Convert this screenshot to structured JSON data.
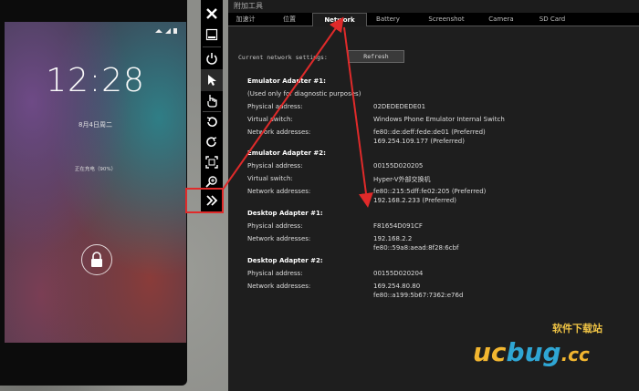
{
  "phone": {
    "clock": "12:28",
    "date": "8月4日周二",
    "charging": "正在充电（90%）",
    "status_icons": "wifi-icon signal-icon battery-icon"
  },
  "toolbar": {
    "items": [
      "close-icon",
      "minimize-icon",
      "power-icon",
      "cursor-icon",
      "touch-icon",
      "rotate-left-icon",
      "rotate-right-icon",
      "fit-screen-icon",
      "zoom-icon",
      "expand-tools-icon"
    ]
  },
  "panel": {
    "title": "附加工具",
    "tabs": [
      "加速计",
      "位置",
      "Network",
      "Battery",
      "Screenshot",
      "Camera",
      "SD Card"
    ],
    "active_tab": "Network",
    "current_label": "Current network settings:",
    "refresh_label": "Refresh",
    "field_labels": {
      "physical": "Physical address:",
      "virtual": "Virtual switch:",
      "network": "Network addresses:"
    },
    "adapters": [
      {
        "title": "Emulator Adapter #1:",
        "note": "(Used only for diagnostic purposes)",
        "physical": "02DEDEDEDE01",
        "virtual": "Windows Phone Emulator Internal Switch",
        "net1": "fe80::de:deff:fede:de01 (Preferred)",
        "net2": "169.254.109.177 (Preferred)"
      },
      {
        "title": "Emulator Adapter #2:",
        "physical": "00155D020205",
        "virtual": "Hyper-V外部交换机",
        "net1": "fe80::215:5dff:fe02:205 (Preferred)",
        "net2": "192.168.2.233 (Preferred)"
      },
      {
        "title": "Desktop Adapter #1:",
        "physical": "F81654D091CF",
        "net1": "192.168.2.2",
        "net2": "fe80::59a8:aead:8f28:6cbf"
      },
      {
        "title": "Desktop Adapter #2:",
        "physical": "00155D020204",
        "net1": "169.254.80.80",
        "net2": "fe80::a199:5b67:7362:e76d"
      }
    ]
  },
  "watermark": {
    "cn": "软件下载站",
    "en_a": "uc",
    "en_b": "bug",
    "en_c": ".cc"
  },
  "colors": {
    "annotation": "#e02a2a",
    "panel_bg": "#1e1e1e"
  }
}
